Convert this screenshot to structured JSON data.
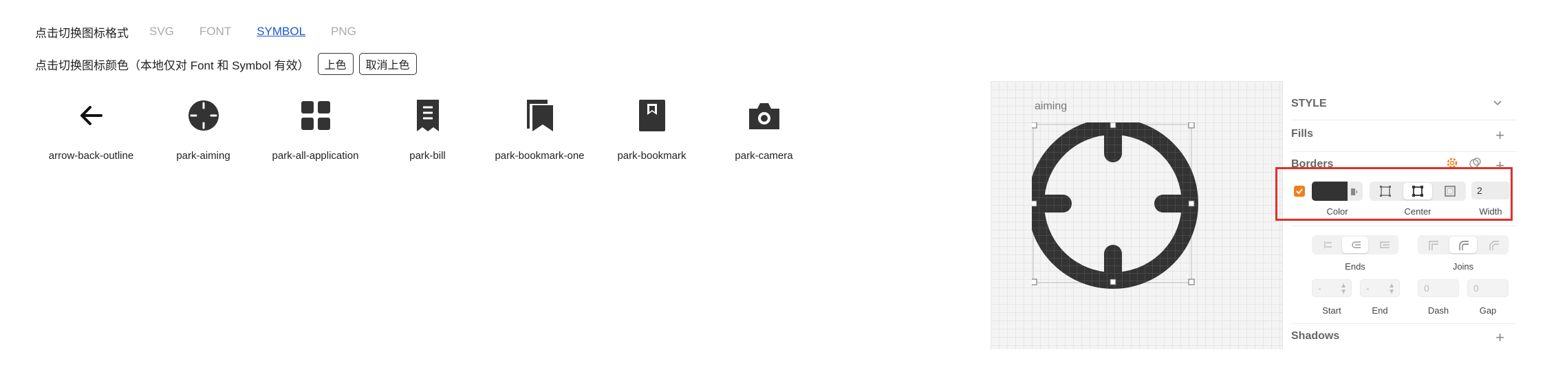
{
  "format_row": {
    "label": "点击切换图标格式",
    "options": [
      "SVG",
      "FONT",
      "SYMBOL",
      "PNG"
    ],
    "active": "SYMBOL"
  },
  "color_row": {
    "label": "点击切换图标颜色（本地仅对 Font 和 Symbol 有效）",
    "color_button": "上色",
    "uncolor_button": "取消上色"
  },
  "icons": [
    {
      "name": "arrow-back-outline",
      "icon": "arrow-back-icon"
    },
    {
      "name": "park-aiming",
      "icon": "aiming-icon"
    },
    {
      "name": "park-all-application",
      "icon": "all-application-icon"
    },
    {
      "name": "park-bill",
      "icon": "bill-icon"
    },
    {
      "name": "park-bookmark-one",
      "icon": "bookmark-one-icon"
    },
    {
      "name": "park-bookmark",
      "icon": "bookmark-icon"
    },
    {
      "name": "park-camera",
      "icon": "camera-icon"
    }
  ],
  "canvas": {
    "artboard_label": "aiming"
  },
  "inspector": {
    "style_title": "STYLE",
    "fills_title": "Fills",
    "borders_title": "Borders",
    "border": {
      "enabled": true,
      "color_hex": "#333333",
      "position": "Center",
      "width": "2",
      "color_label": "Color",
      "position_label": "Center",
      "width_label": "Width"
    },
    "ends_label": "Ends",
    "joins_label": "Joins",
    "start_label": "Start",
    "end_label": "End",
    "dash_label": "Dash",
    "gap_label": "Gap",
    "start_value": "-",
    "end_value": "-",
    "dash_value": "0",
    "gap_value": "0",
    "shadows_title": "Shadows"
  },
  "colors": {
    "accent_link": "#1a55d4",
    "highlight_box": "#e0302a",
    "checkbox": "#f07f1e",
    "icon_fill": "#333333"
  }
}
